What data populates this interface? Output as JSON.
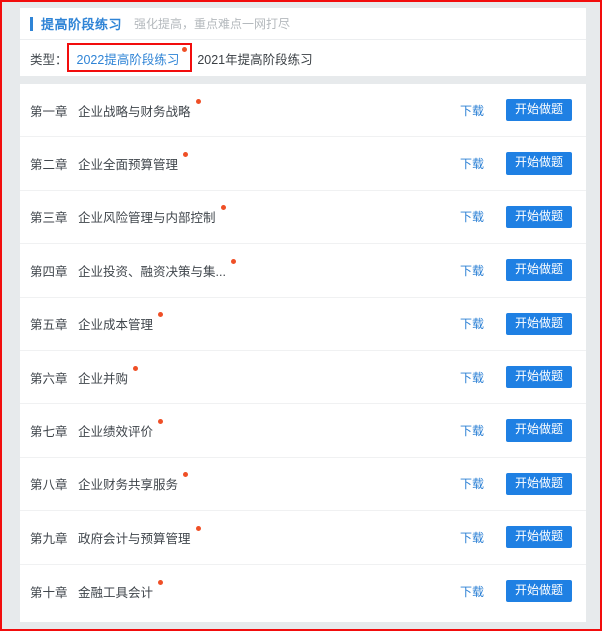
{
  "header": {
    "title": "提高阶段练习",
    "subtitle": "强化提高，重点难点一网打尽",
    "accent_color": "#2f84d6"
  },
  "filter": {
    "label": "类型：",
    "tabs": [
      {
        "label": "2022提高阶段练习",
        "active": true,
        "has_new_dot": true
      },
      {
        "label": "2021年提高阶段练习",
        "active": false,
        "has_new_dot": false
      }
    ]
  },
  "list": {
    "download_label": "下载",
    "start_label": "开始做题",
    "new_dot_color": "#ef4f26",
    "button_color": "#1f80e3",
    "link_color": "#2a7fd4",
    "rows": [
      {
        "num": "第一章",
        "title": "企业战略与财务战略"
      },
      {
        "num": "第二章",
        "title": "企业全面预算管理"
      },
      {
        "num": "第三章",
        "title": "企业风险管理与内部控制"
      },
      {
        "num": "第四章",
        "title": "企业投资、融资决策与集..."
      },
      {
        "num": "第五章",
        "title": "企业成本管理"
      },
      {
        "num": "第六章",
        "title": "企业并购"
      },
      {
        "num": "第七章",
        "title": "企业绩效评价"
      },
      {
        "num": "第八章",
        "title": "企业财务共享服务"
      },
      {
        "num": "第九章",
        "title": "政府会计与预算管理"
      },
      {
        "num": "第十章",
        "title": "金融工具会计"
      }
    ]
  },
  "annotation": {
    "outer_border_color": "#f20d0d",
    "tab_highlight_color": "#f20d0d"
  }
}
